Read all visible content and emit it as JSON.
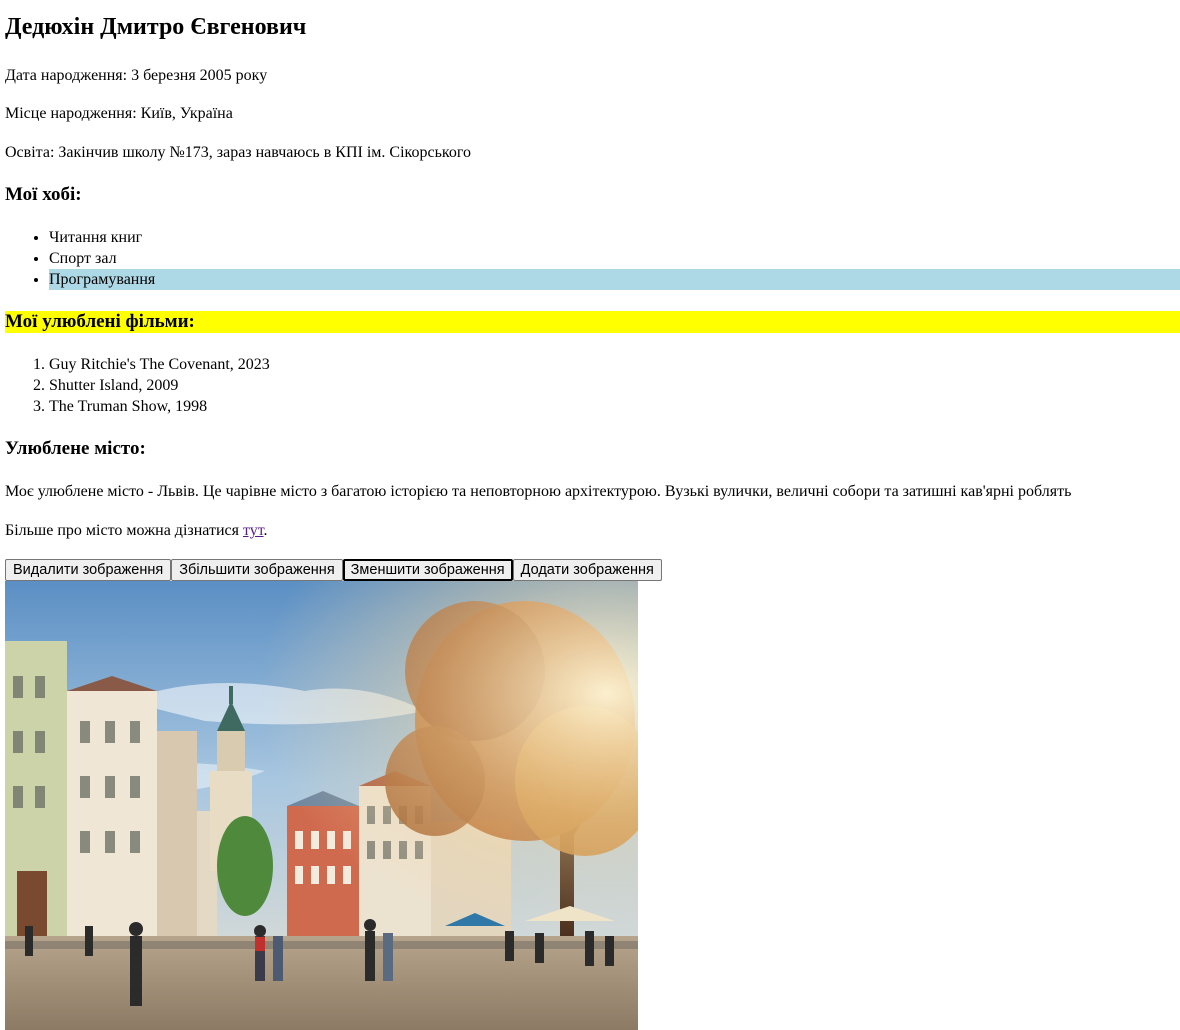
{
  "profile": {
    "name": "Дедюхін Дмитро Євгенович",
    "birth_date": "Дата народження: 3 березня 2005 року",
    "birth_place": "Місце народження: Київ, Україна",
    "education": "Освіта: Закінчив школу №173, зараз навчаюсь в КПІ ім. Сікорського"
  },
  "hobbies": {
    "heading": "Мої хобі:",
    "items": [
      "Читання книг",
      "Спорт зал",
      "Програмування"
    ]
  },
  "films": {
    "heading": "Мої улюблені фільми:",
    "items": [
      "Guy Ritchie's The Covenant, 2023",
      "Shutter Island, 2009",
      "The Truman Show, 1998"
    ]
  },
  "city": {
    "heading": "Улюблене місто:",
    "description": "Моє улюблене місто - Львів. Це чарівне місто з багатою історією та неповторною архітектурою. Вузькі вулички, величні собори та затишні кав'ярні роблять",
    "more_prefix": "Більше про місто можна дізнатися ",
    "more_link": "тут",
    "more_suffix": "."
  },
  "buttons": {
    "delete": "Видалити зображення",
    "enlarge": "Збільшити зображення",
    "shrink": "Зменшити зображення",
    "add": "Додати зображення"
  },
  "colors": {
    "hobby_highlight": "#add8e6",
    "film_heading_highlight": "#ffff00",
    "link": "#551a8b"
  }
}
